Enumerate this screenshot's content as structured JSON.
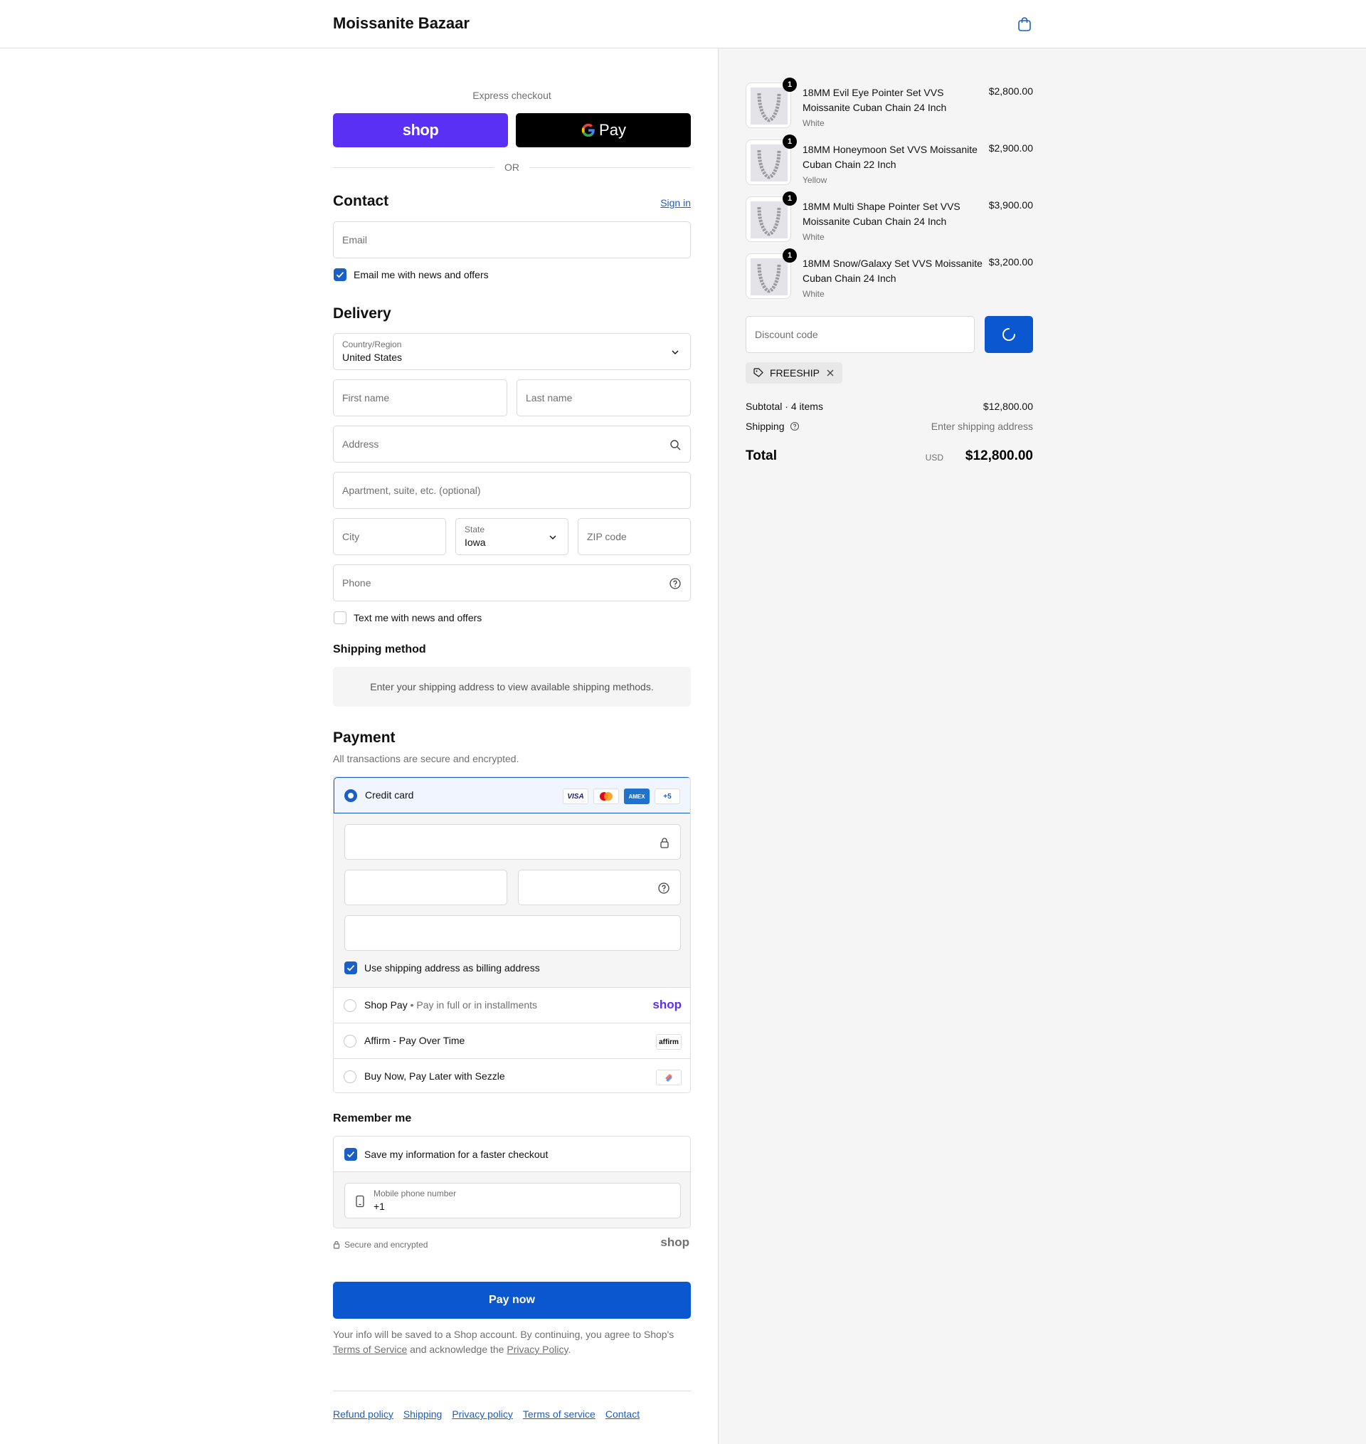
{
  "header": {
    "brand": "Moissanite Bazaar",
    "cart_icon": "shopping-bag-icon"
  },
  "express": {
    "label": "Express checkout",
    "shop_label": "shop",
    "gpay_label": "Pay",
    "or_label": "OR"
  },
  "contact": {
    "title": "Contact",
    "sign_in": "Sign in",
    "email_placeholder": "Email",
    "news_label": "Email me with news and offers",
    "news_checked": true
  },
  "delivery": {
    "title": "Delivery",
    "country_label": "Country/Region",
    "country_value": "United States",
    "first_name_placeholder": "First name",
    "last_name_placeholder": "Last name",
    "address_placeholder": "Address",
    "apartment_placeholder": "Apartment, suite, etc. (optional)",
    "city_placeholder": "City",
    "state_label": "State",
    "state_value": "Iowa",
    "zip_placeholder": "ZIP code",
    "phone_placeholder": "Phone",
    "sms_label": "Text me with news and offers",
    "sms_checked": false
  },
  "shipping_method": {
    "title": "Shipping method",
    "message": "Enter your shipping address to view available shipping methods."
  },
  "payment": {
    "title": "Payment",
    "subtitle": "All transactions are secure and encrypted.",
    "credit_card_label": "Credit card",
    "card_brands": [
      "VISA",
      "mastercard",
      "AMEX",
      "+5"
    ],
    "billing_label": "Use shipping address as billing address",
    "billing_checked": true,
    "shop_pay_label": "Shop Pay",
    "shop_pay_sub": "Pay in full or in installments",
    "shop_pay_logo": "shop",
    "affirm_label": "Affirm - Pay Over Time",
    "affirm_logo": "affirm",
    "sezzle_label": "Buy Now, Pay Later with Sezzle"
  },
  "remember": {
    "title": "Remember me",
    "save_label": "Save my information for a faster checkout",
    "save_checked": true,
    "phone_label": "Mobile phone number",
    "phone_value": "+1",
    "secure_label": "Secure and encrypted",
    "shop_logo": "shop"
  },
  "pay_now": "Pay now",
  "legal": {
    "prefix": "Your info will be saved to a Shop account. By continuing, you agree to Shop's ",
    "tos": "Terms of Service",
    "middle": " and acknowledge the ",
    "privacy": "Privacy Policy",
    "suffix": "."
  },
  "footer_links": [
    "Refund policy",
    "Shipping",
    "Privacy policy",
    "Terms of service",
    "Contact"
  ],
  "summary": {
    "items": [
      {
        "name": "18MM Evil Eye Pointer Set VVS Moissanite Cuban Chain 24 Inch",
        "variant": "White",
        "price": "$2,800.00",
        "qty": "1"
      },
      {
        "name": "18MM Honeymoon Set VVS Moissanite Cuban Chain 22 Inch",
        "variant": "Yellow",
        "price": "$2,900.00",
        "qty": "1"
      },
      {
        "name": "18MM Multi Shape Pointer Set VVS Moissanite Cuban Chain 24 Inch",
        "variant": "White",
        "price": "$3,900.00",
        "qty": "1"
      },
      {
        "name": "18MM Snow/Galaxy Set VVS Moissanite Cuban Chain 24 Inch",
        "variant": "White",
        "price": "$3,200.00",
        "qty": "1"
      }
    ],
    "discount_placeholder": "Discount code",
    "discount_tag": "FREESHIP",
    "subtotal_label": "Subtotal · 4 items",
    "subtotal_value": "$12,800.00",
    "shipping_label": "Shipping",
    "shipping_value": "Enter shipping address",
    "total_label": "Total",
    "currency": "USD",
    "total_value": "$12,800.00"
  },
  "colors": {
    "accent": "#1a5ec8",
    "pay_button": "#0b57d0",
    "shop_pay": "#5a31f4"
  }
}
